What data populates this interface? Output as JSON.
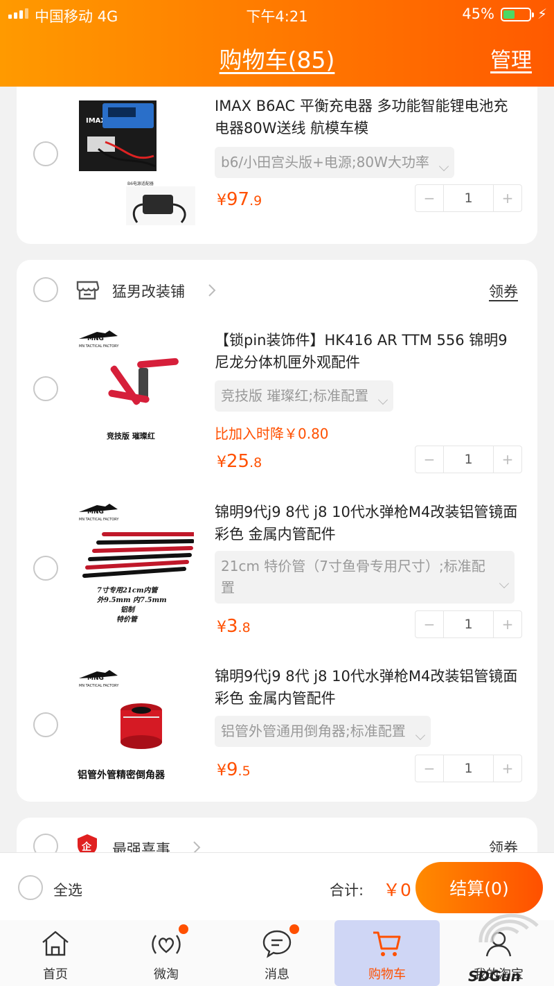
{
  "status_bar": {
    "carrier": "中国移动  4G",
    "time": "下午4:21",
    "battery": "45%"
  },
  "nav": {
    "title": "购物车(85)",
    "manage": "管理"
  },
  "items_group1": [
    {
      "title": "IMAX B6AC 平衡充电器 多功能智能锂电池充电器80W送线 航模车模",
      "sku": "b6/小田宫头版+电源;80W大功率",
      "price_symbol": "¥",
      "price_int": "97",
      "price_dec": ".9",
      "qty": "1",
      "thumb_caption": "B6电源适配器"
    }
  ],
  "shop2": {
    "name": "猛男改装铺",
    "coupon": "领券",
    "items": [
      {
        "title": "【锁pin装饰件】HK416 AR TTM 556 锦明9 尼龙分体机匣外观配件",
        "sku": "竞技版 璀璨红;标准配置",
        "drop_note": "比加入时降￥0.80",
        "price_symbol": "¥",
        "price_int": "25",
        "price_dec": ".8",
        "qty": "1",
        "thumb_caption": "竞技版 璀璨红",
        "thumb_brand": "MN TACTICAL FACTORY"
      },
      {
        "title": "锦明9代j9 8代  j8 10代水弹枪M4改装铝管镜面彩色 金属内管配件",
        "sku": "21cm 特价管（7寸鱼骨专用尺寸）;标准配置",
        "price_symbol": "¥",
        "price_int": "3",
        "price_dec": ".8",
        "qty": "1",
        "thumb_caption_lines": [
          "7寸专用21cm内管",
          "外9.5mm 内7.5mm",
          "铝制",
          "特价管"
        ],
        "thumb_brand": "MN TACTICAL FACTORY"
      },
      {
        "title": "锦明9代j9 8代  j8 10代水弹枪M4改装铝管镜面彩色 金属内管配件",
        "sku": "铝管外管通用倒角器;标准配置",
        "price_symbol": "¥",
        "price_int": "9",
        "price_dec": ".5",
        "qty": "1",
        "thumb_caption": "铝管外管精密倒角器",
        "thumb_brand": "MN TACTICAL FACTORY"
      }
    ]
  },
  "shop3": {
    "name": "最强喜事",
    "coupon": "领券"
  },
  "checkout": {
    "select_all": "全选",
    "total_label": "合计:",
    "total_value": "￥0",
    "button": "结算(0)"
  },
  "tabs": [
    {
      "label": "首页",
      "icon": "home-icon"
    },
    {
      "label": "微淘",
      "icon": "weitao-icon"
    },
    {
      "label": "消息",
      "icon": "message-icon"
    },
    {
      "label": "购物车",
      "icon": "cart-icon"
    },
    {
      "label": "我的淘宝",
      "icon": "profile-icon"
    }
  ],
  "watermark": "SDGun",
  "colors": {
    "accent": "#ff5000",
    "header_start": "#ff9a00",
    "header_end": "#ff5a00",
    "battery": "#4cd964"
  },
  "glyphs": {
    "minus": "−",
    "plus": "+"
  }
}
